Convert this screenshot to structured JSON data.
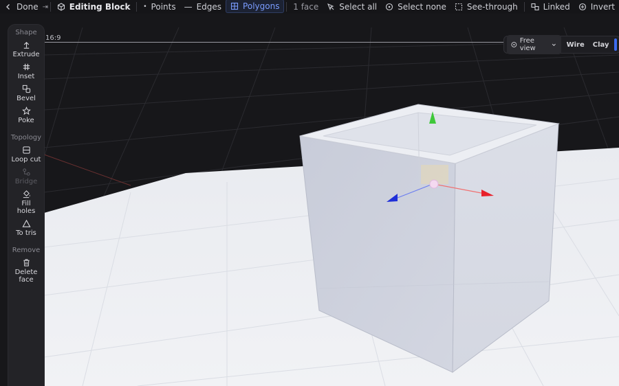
{
  "topbar": {
    "done_label": "Done",
    "mode_title": "Editing Block",
    "points_label": "Points",
    "edges_label": "Edges",
    "polygons_label": "Polygons",
    "selection_count": "1 face",
    "select_all_label": "Select all",
    "select_none_label": "Select none",
    "see_through_label": "See-through",
    "linked_label": "Linked",
    "invert_label": "Invert"
  },
  "sidebar": {
    "shape_header": "Shape",
    "extrude": "Extrude",
    "inset": "Inset",
    "bevel": "Bevel",
    "poke": "Poke",
    "topology_header": "Topology",
    "loop_cut": "Loop cut",
    "bridge": "Bridge",
    "fill_holes": "Fill holes",
    "to_tris": "To tris",
    "remove_header": "Remove",
    "delete_face": "Delete face"
  },
  "viewport": {
    "aspect_ratio": "16:9",
    "view_mode": "Free view",
    "wire_label": "Wire",
    "clay_label": "Clay"
  },
  "colors": {
    "accent": "#3d6cf0",
    "gizmo_x": "#e8202a",
    "gizmo_y": "#3fc83a",
    "gizmo_z": "#1f2fd8"
  }
}
